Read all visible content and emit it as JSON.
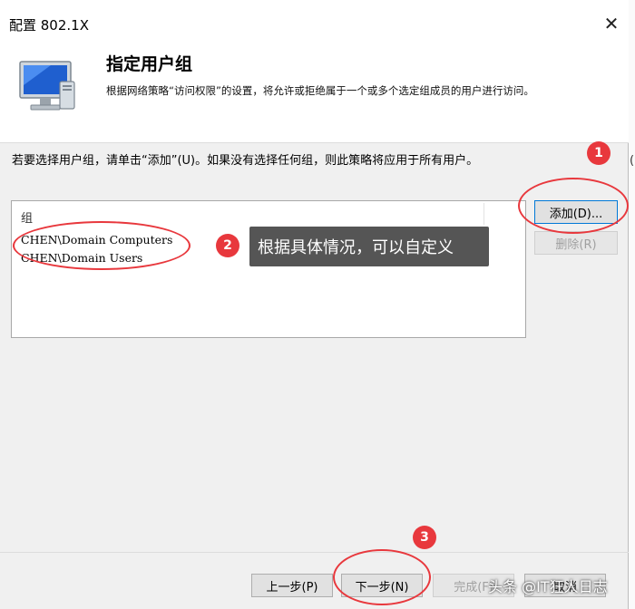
{
  "window": {
    "title": "配置 802.1X",
    "close_glyph": "✕"
  },
  "header": {
    "title": "指定用户组",
    "description": "根据网络策略“访问权限”的设置，将允许或拒绝属于一个或多个选定组成员的用户进行访问。",
    "icon": "monitor-icon"
  },
  "instruction": "若要选择用户组，请单击“添加”(U)。如果没有选择任何组，则此策略将应用于所有用户。",
  "group_list": {
    "column_header": "组",
    "rows": [
      "CHEN\\Domain Computers",
      "CHEN\\Domain Users"
    ]
  },
  "buttons": {
    "add": "添加(D)...",
    "remove": "删除(R)",
    "previous": "上一步(P)",
    "next": "下一步(N)",
    "finish": "完成(F)",
    "cancel": "取消"
  },
  "annotations": {
    "badge_1": "1",
    "badge_2": "2",
    "badge_3": "3",
    "note": "根据具体情况，可以自定义",
    "color": "#e8383d"
  },
  "watermark": "头条 @IT狂人日志"
}
